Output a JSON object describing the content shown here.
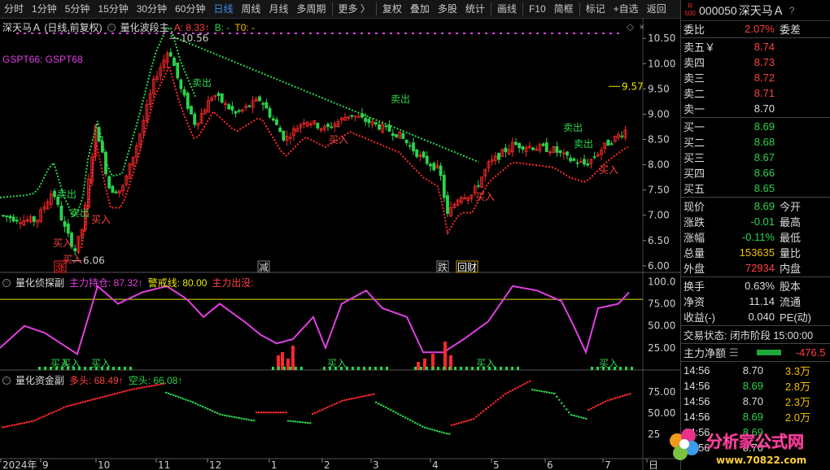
{
  "toolbar": {
    "items": [
      "分时",
      "1分钟",
      "5分钟",
      "15分钟",
      "30分钟",
      "60分钟",
      "日线",
      "周线",
      "月线",
      "多周期",
      "更多 〉",
      "复权",
      "叠加",
      "多股",
      "统计",
      "画线",
      "F10",
      "简框",
      "标记",
      "+自选",
      "返回"
    ],
    "active_index": 6
  },
  "main_panel": {
    "title": "深天马Ａ (日线,前复权)",
    "indicator": "量化波段主",
    "a_label": "A: 8.33↑",
    "b_label": "B: -",
    "t0_label": "T0: -",
    "legend": "GSPT66:  GSPT68",
    "high_label": "10.56",
    "low_label": "6.06",
    "right_tag": "9.57",
    "signals": [
      {
        "t": "卖出",
        "c": "#2bd44c"
      },
      {
        "t": "卖出",
        "c": "#2bd44c"
      },
      {
        "t": "买入",
        "c": "#ff4040"
      },
      {
        "t": "买入",
        "c": "#ff4040"
      },
      {
        "t": "买入",
        "c": "#ff4040"
      },
      {
        "t": "卖出",
        "c": "#2bd44c"
      },
      {
        "t": "买入",
        "c": "#ff4040"
      },
      {
        "t": "卖出",
        "c": "#2bd44c"
      },
      {
        "t": "买入",
        "c": "#ff4040"
      },
      {
        "t": "卖出",
        "c": "#2bd44c"
      },
      {
        "t": "卖出",
        "c": "#2bd44c"
      },
      {
        "t": "买入",
        "c": "#ff4040"
      }
    ],
    "badges": [
      "涨",
      "减",
      "跌",
      "回财"
    ],
    "y_ticks": [
      "10.50",
      "10.00",
      "9.50",
      "9.00",
      "8.50",
      "8.00",
      "7.50",
      "7.00",
      "6.50",
      "6.00"
    ]
  },
  "panel2": {
    "title": "量化侦探副",
    "zl_label": "主力持仓: 87.32↑",
    "jj_label": "警戒线: 80.00",
    "out_label": "主力出没:",
    "y_ticks": [
      "100.0",
      "75.00",
      "50.00",
      "25.00"
    ],
    "buy_labels": [
      "买入",
      "买入",
      "买入",
      "买入",
      "买入",
      "买入"
    ]
  },
  "panel3": {
    "title": "量化资金副",
    "long_label": "多头: 68.49↑",
    "short_label": "空头: 66.08↑",
    "y_ticks": [
      "75.00",
      "50.00",
      "25"
    ]
  },
  "x_axis": [
    "2024年",
    "9",
    "10",
    "11",
    "12",
    "1",
    "2",
    "3",
    "4",
    "5",
    "6",
    "7",
    "日"
  ],
  "quote": {
    "code": "000050",
    "name": "深天马Ａ",
    "r_logo": "R 500",
    "webi": {
      "label": "委比",
      "value": "2.07%",
      "label2": "委差"
    },
    "asks": [
      {
        "l": "卖五￥",
        "p": "8.74"
      },
      {
        "l": "卖四",
        "p": "8.73"
      },
      {
        "l": "卖三",
        "p": "8.72"
      },
      {
        "l": "卖二",
        "p": "8.71"
      },
      {
        "l": "卖一",
        "p": "8.70"
      }
    ],
    "bids": [
      {
        "l": "买一",
        "p": "8.69"
      },
      {
        "l": "买二",
        "p": "8.68"
      },
      {
        "l": "买三",
        "p": "8.67"
      },
      {
        "l": "买四",
        "p": "8.66"
      },
      {
        "l": "买五",
        "p": "8.65"
      }
    ],
    "stats": [
      {
        "l": "现价",
        "v": "8.69",
        "c": "g",
        "l2": "今开"
      },
      {
        "l": "涨跌",
        "v": "-0.01",
        "c": "g",
        "l2": "最高"
      },
      {
        "l": "涨幅",
        "v": "-0.11%",
        "c": "g",
        "l2": "最低"
      },
      {
        "l": "总量",
        "v": "153635",
        "c": "y",
        "l2": "量比"
      },
      {
        "l": "外盘",
        "v": "72934",
        "c": "r",
        "l2": "内盘"
      }
    ],
    "stats2": [
      {
        "l": "换手",
        "v": "0.63%",
        "l2": "股本"
      },
      {
        "l": "净资",
        "v": "11.14",
        "l2": "流通"
      },
      {
        "l": "收益(-)",
        "v": "0.040",
        "l2": "PE(动)"
      }
    ],
    "trade_status": "交易状态: 闭市阶段 15:00:00",
    "net_label": "主力净额",
    "net_value": "-476.5",
    "ticks": [
      {
        "t": "14:56",
        "p": "8.70",
        "v": "3.3万",
        "c": "w"
      },
      {
        "t": "14:56",
        "p": "8.69",
        "v": "2.8万",
        "c": "g"
      },
      {
        "t": "14:56",
        "p": "8.70",
        "v": "2.3万",
        "c": "w"
      },
      {
        "t": "14:56",
        "p": "8.69",
        "v": "2.0万",
        "c": "g"
      },
      {
        "t": "14:56",
        "p": "8.69",
        "v": "",
        "c": "g"
      },
      {
        "t": "14:56",
        "p": "8.70",
        "v": "",
        "c": "w"
      }
    ]
  },
  "watermark": {
    "text": "分析家公式网",
    "url": "www.70822.com"
  },
  "colors": {
    "up": "#ff2a2a",
    "down": "#2bd44c",
    "accent": "#3d8ef0",
    "magenta": "#e040e0",
    "warn": "#e8e800"
  }
}
